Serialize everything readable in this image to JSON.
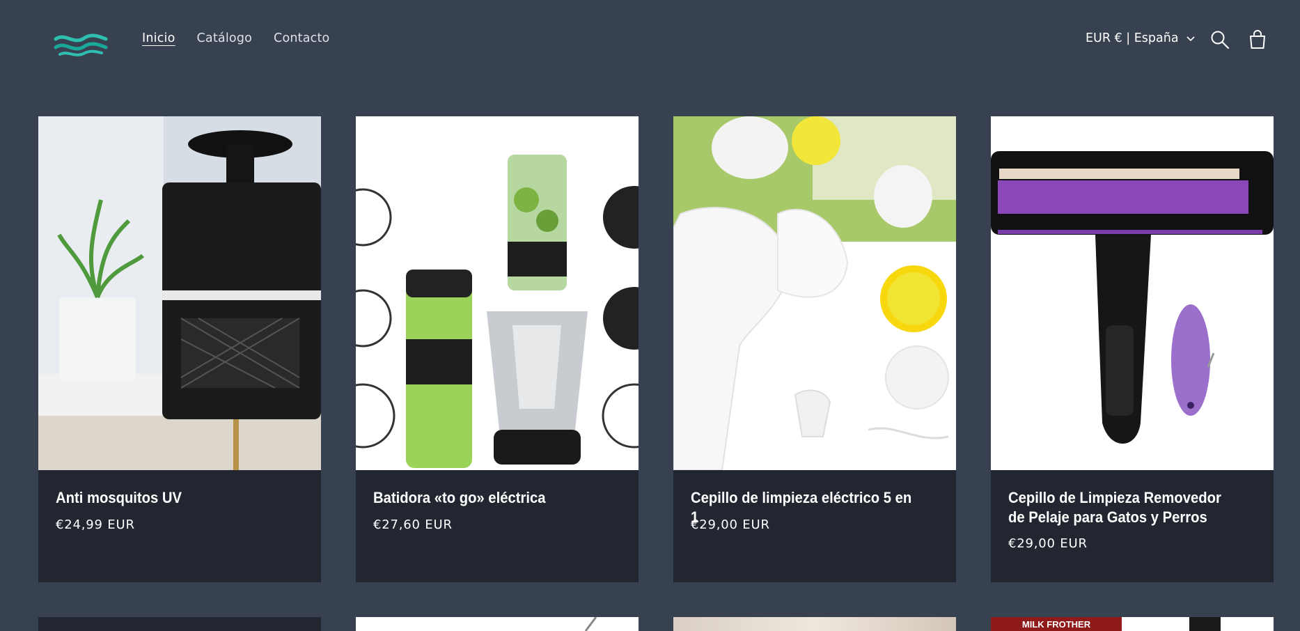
{
  "header": {
    "logo": "waves-logo",
    "nav": [
      {
        "label": "Inicio",
        "active": true
      },
      {
        "label": "Catálogo",
        "active": false
      },
      {
        "label": "Contacto",
        "active": false
      }
    ],
    "locale": "EUR € | España",
    "icons": [
      "search-icon",
      "cart-icon"
    ]
  },
  "products": [
    {
      "title": "Anti mosquitos UV",
      "price": "€24,99 EUR"
    },
    {
      "title": "Batidora «to go» eléctrica",
      "price": "€27,60 EUR"
    },
    {
      "title": "Cepillo de limpieza eléctrico 5 en 1",
      "price": "€29,00 EUR"
    },
    {
      "title": "Cepillo de Limpieza Removedor de Pelaje para Gatos y Perros",
      "price": "€29,00 EUR"
    }
  ],
  "next_row": {
    "badge": "MILK FROTHER"
  },
  "colors": {
    "background": "#37414f",
    "card_info": "#222630",
    "logo_teal": "#2fbfb0"
  }
}
